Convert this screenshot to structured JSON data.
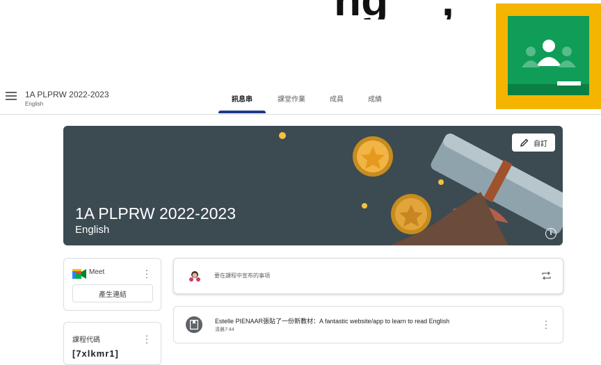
{
  "topbar": {
    "class_name": "1A PLPRW 2022-2023",
    "section": "English",
    "tabs": [
      {
        "label": "訊息串",
        "active": true
      },
      {
        "label": "課堂作業",
        "active": false
      },
      {
        "label": "成員",
        "active": false
      },
      {
        "label": "成績",
        "active": false
      }
    ]
  },
  "banner": {
    "title": "1A PLPRW 2022-2023",
    "subtitle": "English",
    "customize_label": "自訂",
    "info_label": "i"
  },
  "meet": {
    "label": "Meet",
    "generate_link_label": "產生連結"
  },
  "class_code": {
    "label": "課程代碼",
    "value": "[7xlkmr1]"
  },
  "announce": {
    "placeholder": "要在課程中宣布的事項"
  },
  "post": {
    "text": "Estelle PIENAAR張貼了一份新教材：A fantastic website/app to learn to read English",
    "time": "清晨7:44"
  },
  "colors": {
    "accent": "#1e3a8a",
    "banner_bg": "#3c4a52",
    "logo_yellow": "#f4b400",
    "logo_green": "#0f9d58"
  },
  "icons": [
    "menu-icon",
    "pencil-icon",
    "info-icon",
    "meet-camera-icon",
    "more-vert-icon",
    "repost-icon",
    "material-icon",
    "classroom-logo"
  ]
}
